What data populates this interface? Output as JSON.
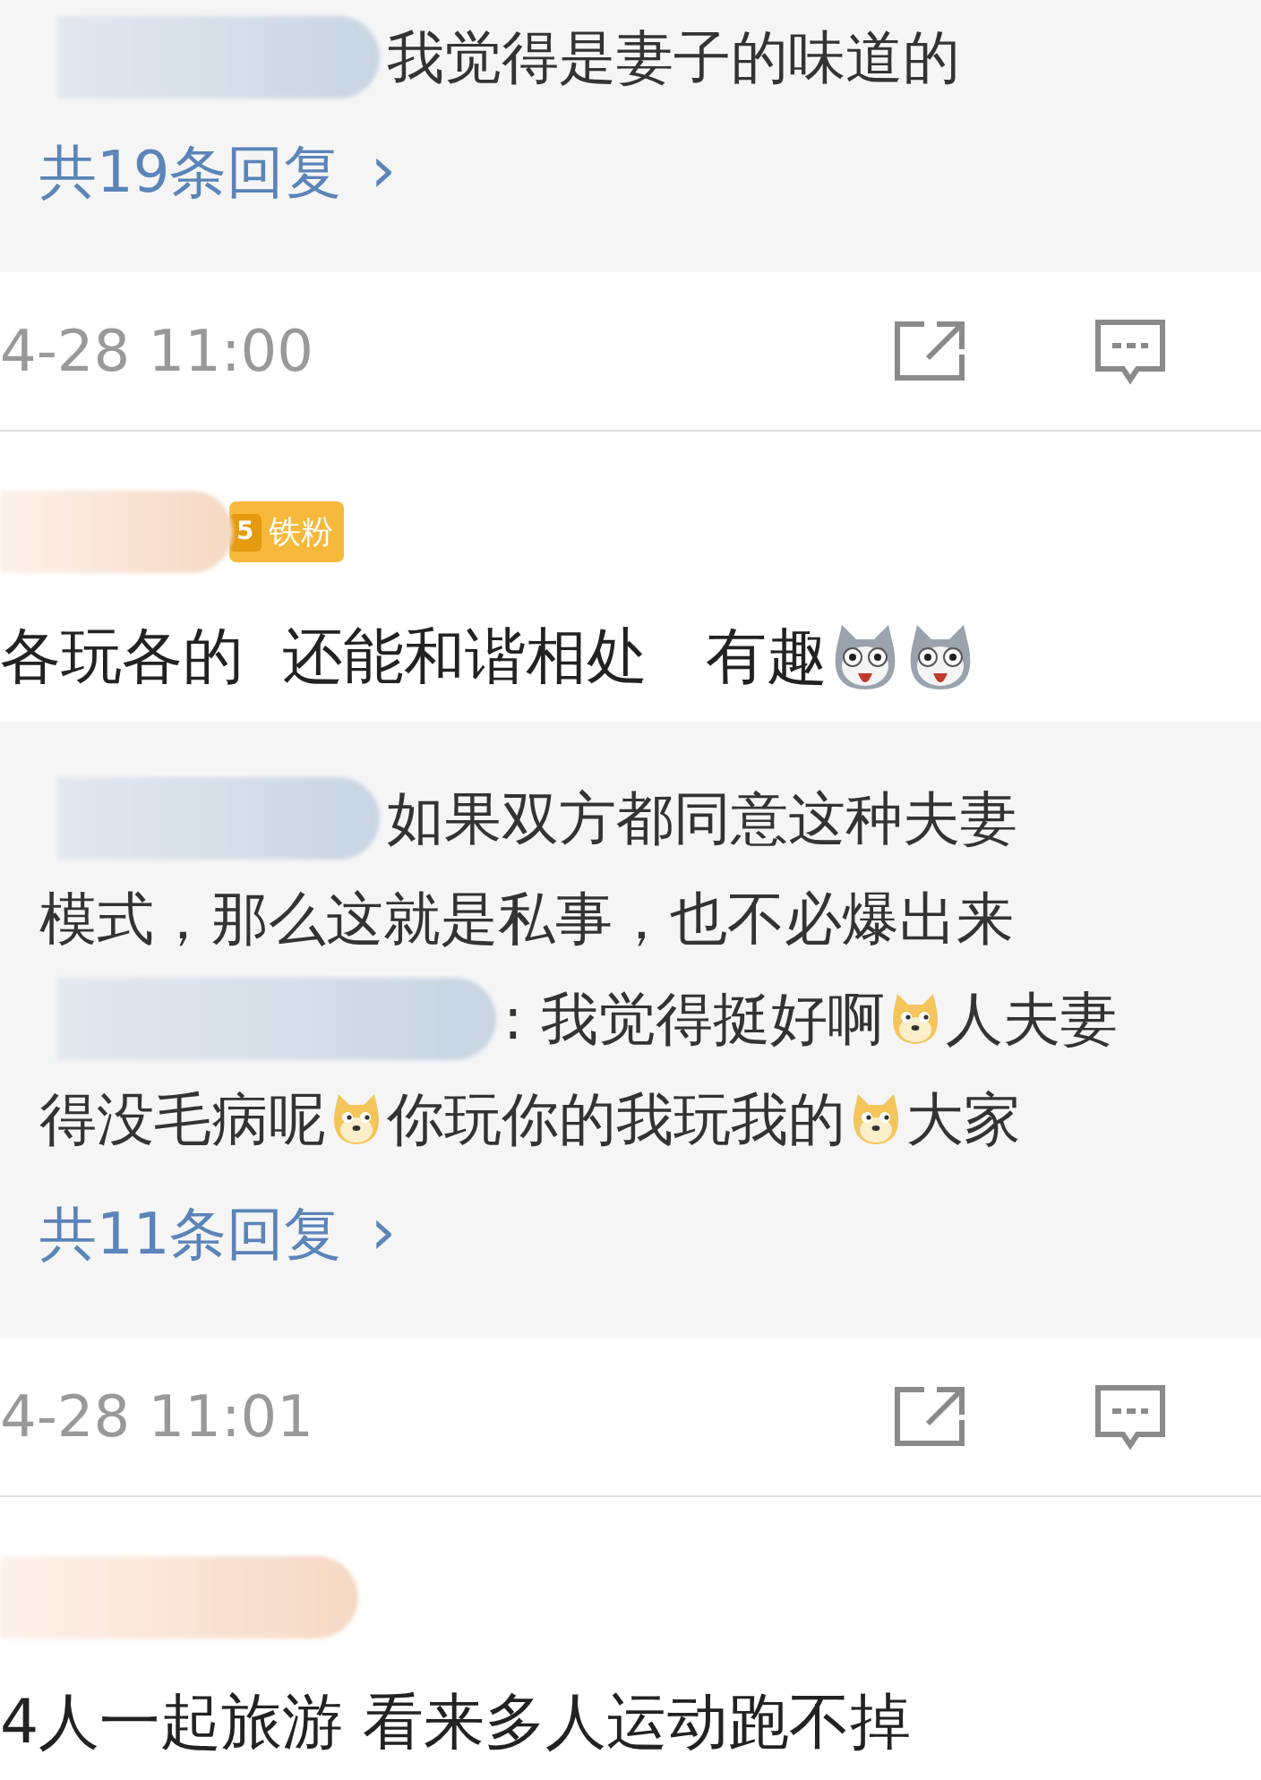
{
  "sections": [
    {
      "kind": "replies",
      "replies": [
        {
          "segments": [
            {
              "kind": "text",
              "text": "我觉得是妻子的味道的"
            }
          ]
        }
      ],
      "more_link": "共19条回复",
      "chevron": "›"
    },
    {
      "kind": "footer",
      "time": "4-28 11:00"
    },
    {
      "kind": "comment",
      "badge": {
        "level": "5",
        "label": "铁粉"
      },
      "segments": [
        {
          "kind": "text",
          "text": "各玩各的  还能和谐相处   有趣"
        },
        {
          "kind": "husky"
        },
        {
          "kind": "husky"
        }
      ]
    },
    {
      "kind": "replies",
      "replies": [
        {
          "segments": [
            {
              "kind": "text",
              "text": "如果双方都同意这种夫妻"
            }
          ]
        },
        {
          "segments": [
            {
              "kind": "text",
              "text": "模式，那么这就是私事，也不必爆出来"
            }
          ]
        },
        {
          "segments": [
            {
              "kind": "text",
              "text": ": 我觉得挺好啊"
            },
            {
              "kind": "doge"
            },
            {
              "kind": "text",
              "text": "人夫妻"
            }
          ]
        },
        {
          "segments": [
            {
              "kind": "text",
              "text": "得没毛病呢"
            },
            {
              "kind": "doge"
            },
            {
              "kind": "text",
              "text": "你玩你的我玩我的"
            },
            {
              "kind": "doge"
            },
            {
              "kind": "text",
              "text": "大家"
            }
          ]
        }
      ],
      "more_link": "共11条回复",
      "chevron": "›"
    },
    {
      "kind": "footer",
      "time": "4-28 11:01"
    },
    {
      "kind": "comment",
      "segments": [
        {
          "kind": "text",
          "text": "4人一起旅游 看来多人运动跑不掉"
        }
      ]
    }
  ]
}
